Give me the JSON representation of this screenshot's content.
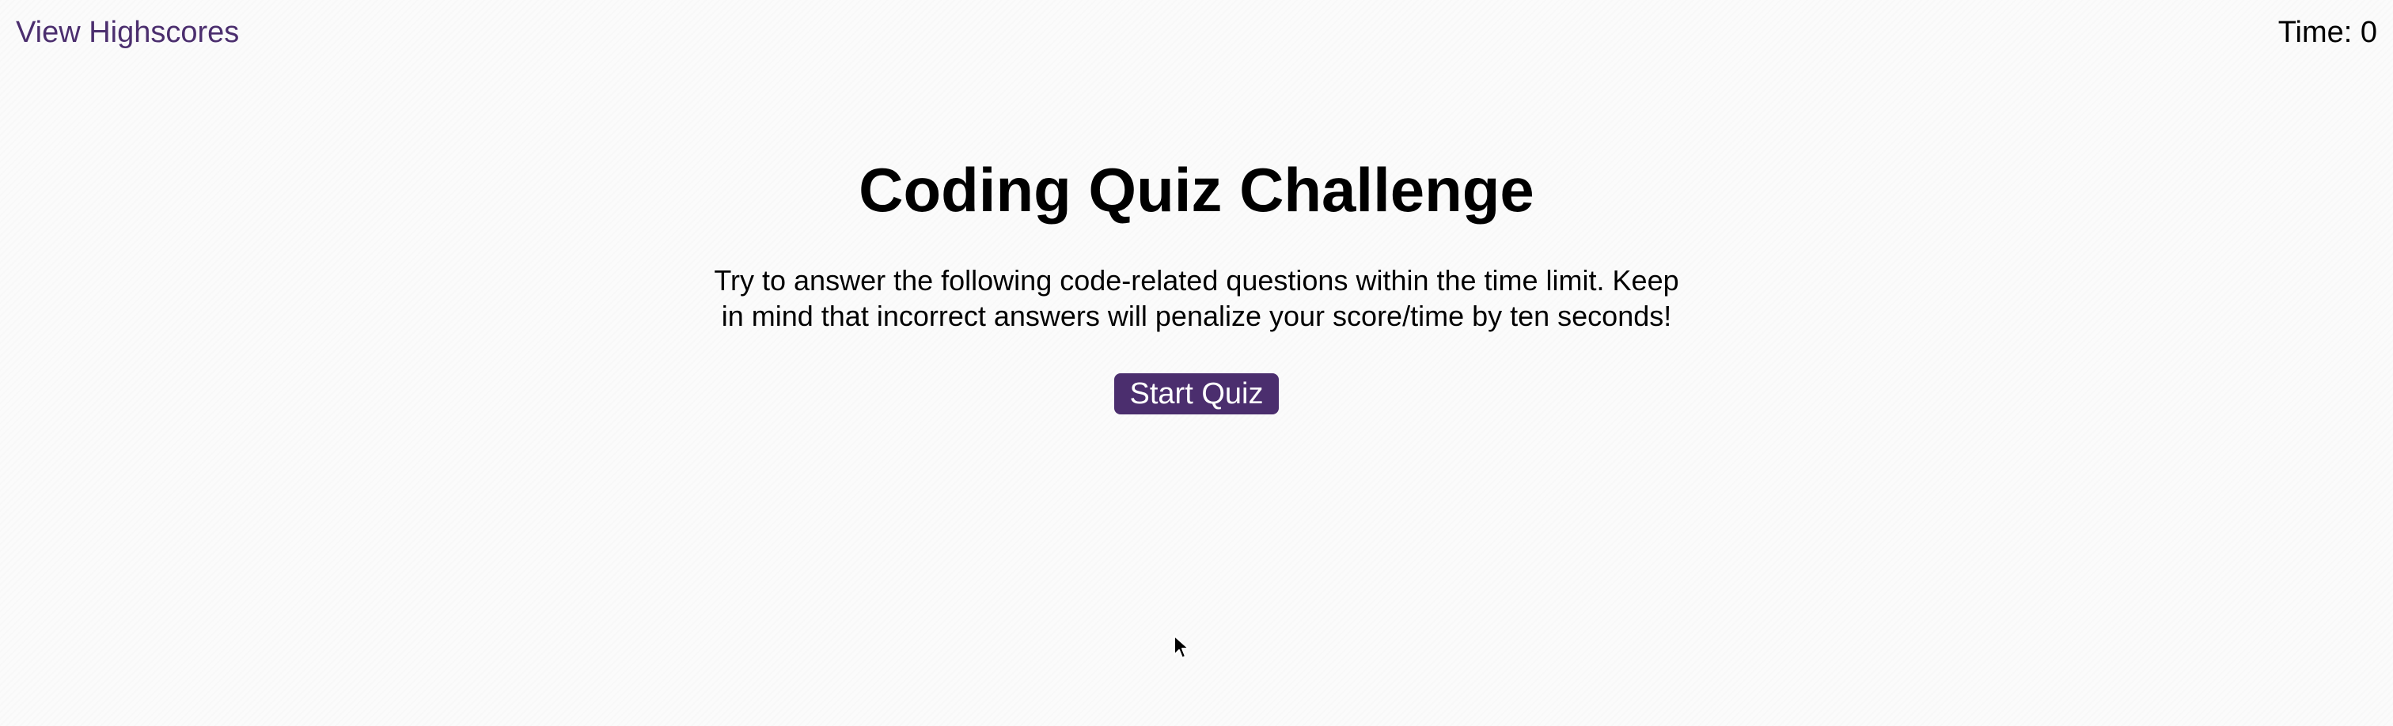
{
  "header": {
    "highscores_label": "View Highscores",
    "timer_label": "Time: 0"
  },
  "main": {
    "title": "Coding Quiz Challenge",
    "intro": "Try to answer the following code-related questions within the time limit. Keep in mind that incorrect answers will penalize your score/time by ten seconds!",
    "start_button_label": "Start Quiz"
  },
  "colors": {
    "accent": "#4b2e6e",
    "background": "#fbfbfb"
  },
  "icons": {
    "cursor": "mouse-pointer-icon"
  }
}
